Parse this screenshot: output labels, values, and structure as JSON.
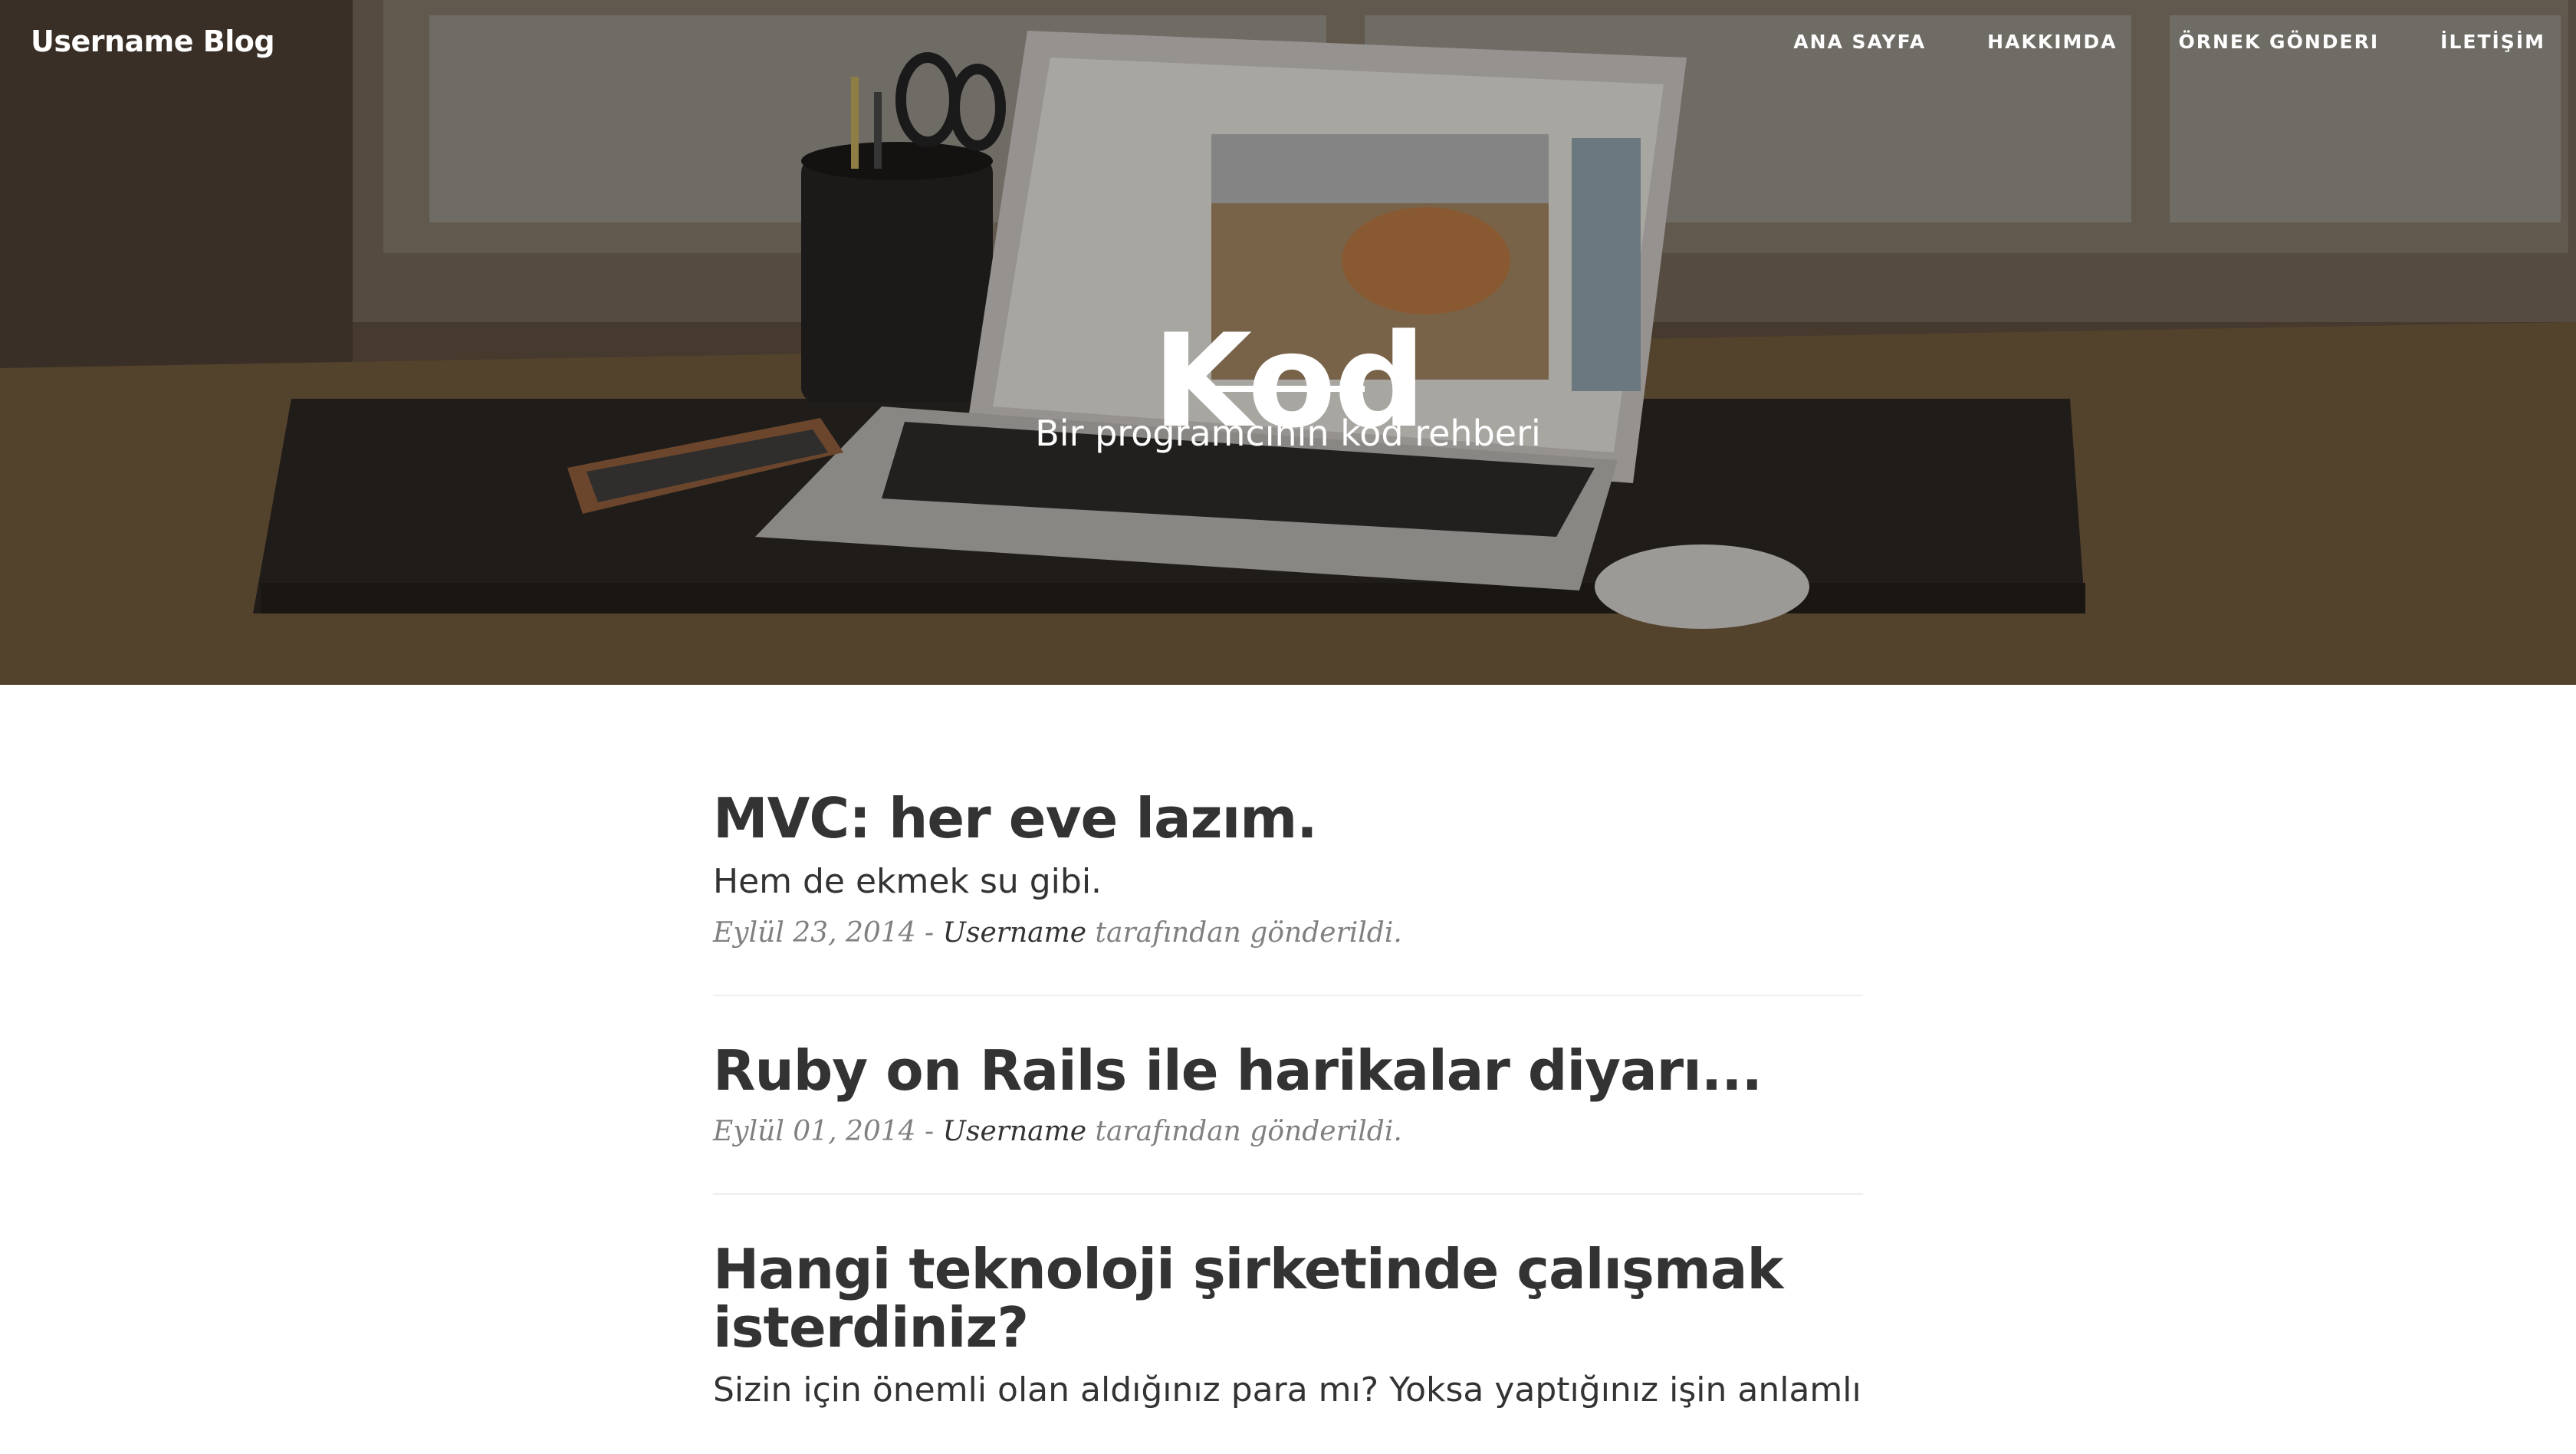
{
  "navbar": {
    "brand": "Username Blog",
    "links": [
      "ANA SAYFA",
      "HAKKIMDA",
      "ÖRNEK GÖNDERI",
      "İLETİŞİM"
    ]
  },
  "hero": {
    "title": "Kod",
    "subtitle": "Bir programcının kod rehberi"
  },
  "posts": [
    {
      "title": "MVC: her eve lazım.",
      "subtitle": "Hem de ekmek su gibi.",
      "date": "Eylül 23, 2014",
      "author": "Username",
      "posted_by_suffix": "tarafından gönderildi."
    },
    {
      "title": "Ruby on Rails ile harikalar diyarı...",
      "subtitle": "",
      "date": "Eylül 01, 2014",
      "author": "Username",
      "posted_by_suffix": "tarafından gönderildi."
    },
    {
      "title": "Hangi teknoloji şirketinde çalışmak isterdiniz?",
      "subtitle": "Sizin için önemli olan aldığınız para mı? Yoksa yaptığınız işin anlamlı"
    }
  ],
  "meta_separator": "-"
}
